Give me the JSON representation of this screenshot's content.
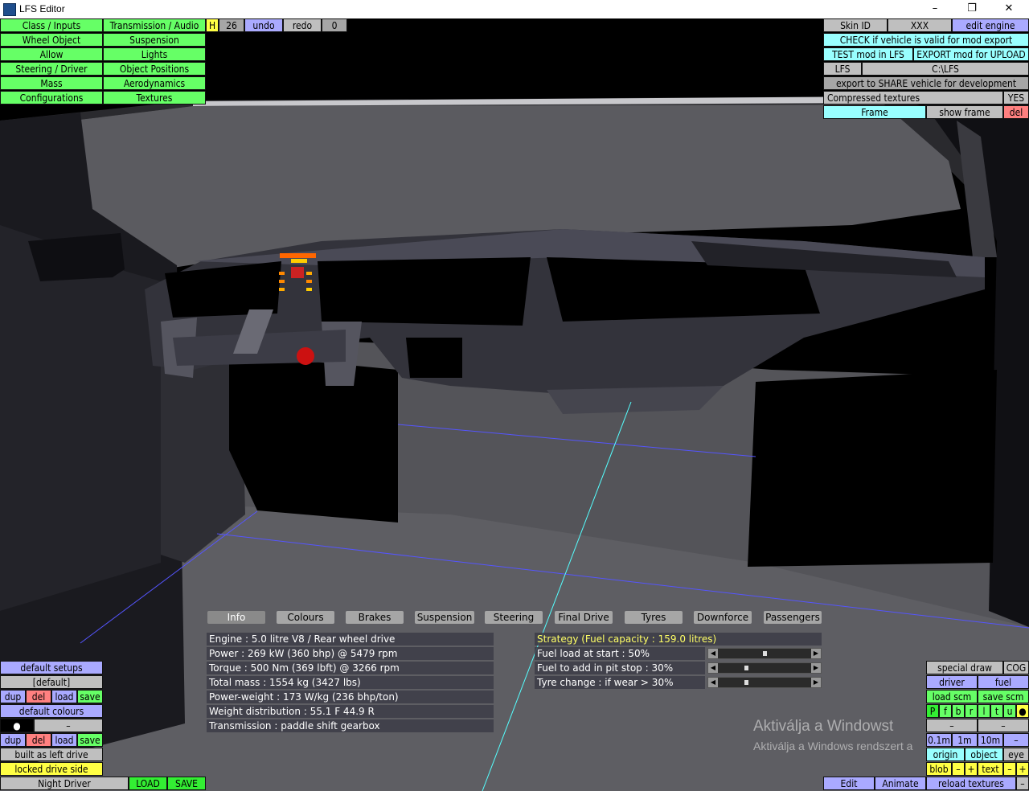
{
  "window": {
    "title": "LFS Editor",
    "controls": [
      "–",
      "❐",
      "✕"
    ]
  },
  "left_menu": [
    [
      "Class / Inputs",
      "Transmission / Audio"
    ],
    [
      "Wheel Object",
      "Suspension"
    ],
    [
      "Allow",
      "Lights"
    ],
    [
      "Steering / Driver",
      "Object Positions"
    ],
    [
      "Mass",
      "Aerodynamics"
    ],
    [
      "Configurations",
      "Textures"
    ]
  ],
  "toolbar": {
    "h": "H",
    "count": "26",
    "undo": "undo",
    "redo": "redo",
    "zero": "0"
  },
  "right_panel": {
    "skin_id": "Skin ID",
    "skin_value": "XXX",
    "edit_engine": "edit engine",
    "check_valid": "CHECK if vehicle is valid for mod export",
    "test_mod": "TEST mod in LFS",
    "export_mod": "EXPORT mod for UPLOAD",
    "lfs": "LFS",
    "lfs_path": "C:\\LFS",
    "export_share": "export to SHARE vehicle for development",
    "compressed": "Compressed textures",
    "compressed_value": "YES",
    "frame": "Frame",
    "show_frame": "show frame",
    "del": "del"
  },
  "tabs": [
    "Info",
    "Colours",
    "Brakes",
    "Suspension",
    "Steering",
    "Final Drive",
    "Tyres",
    "Downforce",
    "Passengers"
  ],
  "info_lines": [
    "Engine : 5.0 litre V8 / Rear wheel drive",
    "Power : 269 kW (360 bhp) @ 5479 rpm",
    "Torque : 500 Nm (369 lbft) @ 3266 rpm",
    "Total mass : 1554 kg (3427 lbs)",
    "Power-weight : 173 W/kg (236 bhp/ton)",
    "Weight distribution : 55.1 F  44.9 R",
    "Transmission : paddle shift gearbox"
  ],
  "strategy": {
    "title": "Strategy (Fuel capacity : 159.0 litres)",
    "rows": [
      {
        "label": "Fuel load at start : 50%",
        "value": 0.5
      },
      {
        "label": "Fuel to add in pit stop : 30%",
        "value": 0.3
      },
      {
        "label": "Tyre change : if wear > 30%",
        "value": 0.3
      }
    ]
  },
  "bottom_left": {
    "default_setups": "default setups",
    "default": "[default]",
    "dup": "dup",
    "del": "del",
    "load": "load",
    "save": "save",
    "default_colours": "default colours",
    "dot": "●",
    "dash": "–",
    "built_as": "built as left drive",
    "locked": "locked drive side",
    "night_driver": "Night Driver",
    "load_caps": "LOAD",
    "save_caps": "SAVE"
  },
  "bottom_right": {
    "special_draw": "special draw",
    "cog": "COG",
    "driver": "driver",
    "fuel": "fuel",
    "load_scm": "load scm",
    "save_scm": "save scm",
    "letters": [
      "P",
      "f",
      "b",
      "r",
      "l",
      "t",
      "u"
    ],
    "dot": "●",
    "dash": "–",
    "steps": [
      "0.1m",
      "1m",
      "10m"
    ],
    "origin": "origin",
    "object": "object",
    "eye": "eye",
    "blob": "blob",
    "minus": "–",
    "plus": "+",
    "text": "text",
    "edit": "Edit",
    "animate": "Animate",
    "reload": "reload textures"
  },
  "watermark": {
    "line1": "Aktiválja a Windowst",
    "line2": "Aktiválja a Windows rendszert a"
  },
  "colors": {
    "green": "#66ff66",
    "lavender": "#aaaaff",
    "cyan": "#99ffff",
    "pink": "#ff8080",
    "yellow": "#ffff44",
    "strategy": "#ffff66"
  }
}
